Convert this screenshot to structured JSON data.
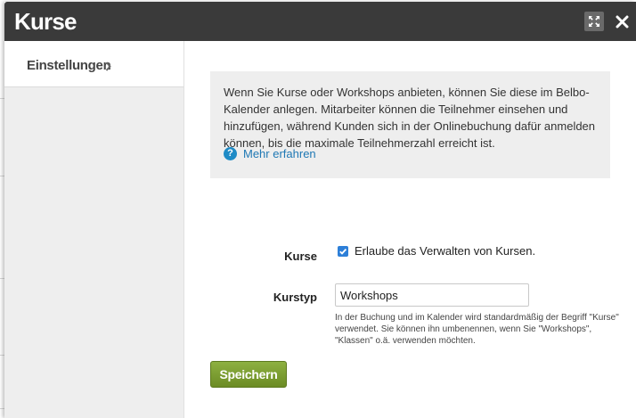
{
  "modal": {
    "title": "Kurse",
    "expand_icon": "expand-icon",
    "close_icon": "close-icon"
  },
  "sidebar": {
    "items": [
      {
        "label": "Einstellungen",
        "icon": "chevron-right-icon"
      }
    ]
  },
  "info": {
    "text": "Wenn Sie Kurse oder Workshops anbieten, können Sie diese im Belbo-Kalender anlegen. Mitarbeiter können die Teilnehmer einsehen und hinzufügen, während Kunden sich in der Onlinebuchung dafür anmelden können, bis die maximale Teilnehmerzahl erreicht ist.",
    "link_label": "Mehr erfahren",
    "link_icon": "help-circle-icon"
  },
  "form": {
    "courses": {
      "label": "Kurse",
      "checked": true,
      "checkbox_label": "Erlaube das Verwalten von Kursen."
    },
    "course_type": {
      "label": "Kurstyp",
      "value": "Workshops",
      "help": "In der Buchung und im Kalender wird standardmäßig der Begriff \"Kurse\" verwendet. Sie können ihn umbenennen, wenn Sie \"Workshops\", \"Klassen\" o.ä. verwenden möchten."
    }
  },
  "actions": {
    "save_label": "Speichern"
  },
  "colors": {
    "header_bg": "#3a3a3a",
    "link": "#1f78b4",
    "save_button": "#7a9c2f",
    "checkbox": "#2d7fd8"
  }
}
